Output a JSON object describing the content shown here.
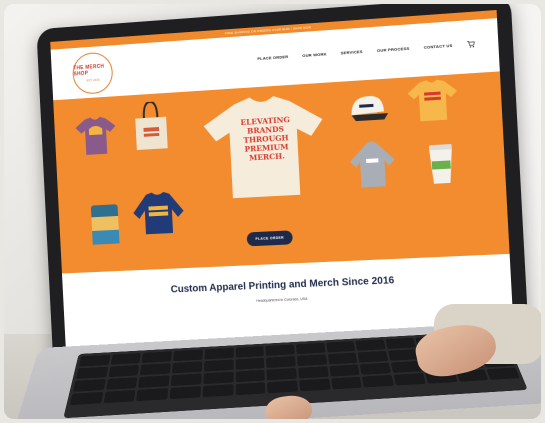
{
  "website": {
    "announcement": "FREE SHIPPING ON ORDERS OVER $100 • SHOP NOW",
    "logo": {
      "top_text": "THE MERCH SHOP",
      "bottom_text": "EST. 2016"
    },
    "nav": [
      "PLACE ORDER",
      "OUR WORK",
      "SERVICES",
      "OUR PROCESS",
      "CONTACT US"
    ],
    "hero": {
      "headline_lines": [
        "ELEVATING",
        "BRANDS",
        "THROUGH",
        "PREMIUM",
        "MERCH."
      ],
      "cta_label": "PLACE ORDER",
      "product_names": [
        "tee-icon",
        "tote-bag-icon",
        "cap-icon",
        "tee-icon",
        "can-icon",
        "sweatshirt-icon",
        "hoodie-icon",
        "cup-icon"
      ]
    },
    "tagline": "Custom Apparel Printing and Merch Since 2016",
    "subline": "Headquartered in Colorado, USA"
  },
  "colors": {
    "accent": "#f28c2e",
    "navy": "#1e2a4a",
    "red_text": "#d63a2e"
  }
}
